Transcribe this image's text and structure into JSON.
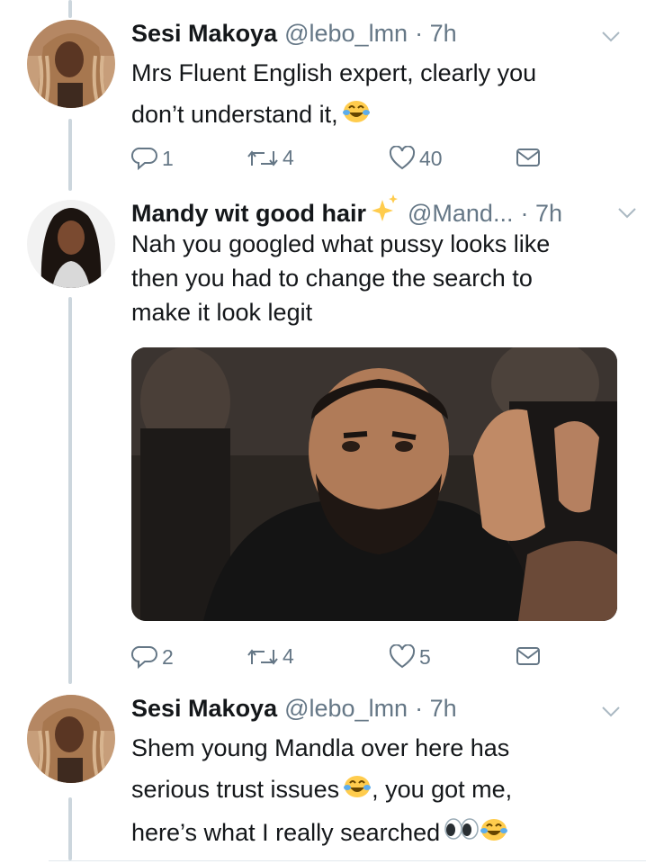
{
  "tweets": [
    {
      "name": "Sesi Makoya",
      "handle": "@lebo_lmn",
      "time": "· 7h",
      "lines": [
        "Mrs Fluent English expert, clearly you",
        "don’t understand it,"
      ],
      "emoji": [
        "face-with-tears-of-joy"
      ],
      "replies": "1",
      "retweets": "4",
      "likes": "40"
    },
    {
      "name": "Mandy wit good hair",
      "name_emoji": "sparkles",
      "handle": "@Mand...",
      "time": "· 7h",
      "lines": [
        "Nah you googled what pussy looks like",
        "then you had to change the search to",
        "make it look legit"
      ],
      "media": "photo of a bearded man in a black hoodie clapping",
      "replies": "2",
      "retweets": "4",
      "likes": "5"
    },
    {
      "name": "Sesi Makoya",
      "handle": "@lebo_lmn",
      "time": "· 7h",
      "lines": [
        "Shem young Mandla over here has",
        "serious trust issues",
        ", you got me,",
        "here’s what I really searched"
      ],
      "emoji": [
        "face-with-tears-of-joy",
        "eyes",
        "face-with-tears-of-joy"
      ]
    }
  ],
  "colors": {
    "text": "#14171a",
    "muted": "#657786",
    "thread": "#ccd6dd",
    "emoji_yellow": "#ffcc4d"
  },
  "icons": [
    "reply-icon",
    "retweet-icon",
    "like-icon",
    "direct-message-icon",
    "chevron-down-icon"
  ]
}
